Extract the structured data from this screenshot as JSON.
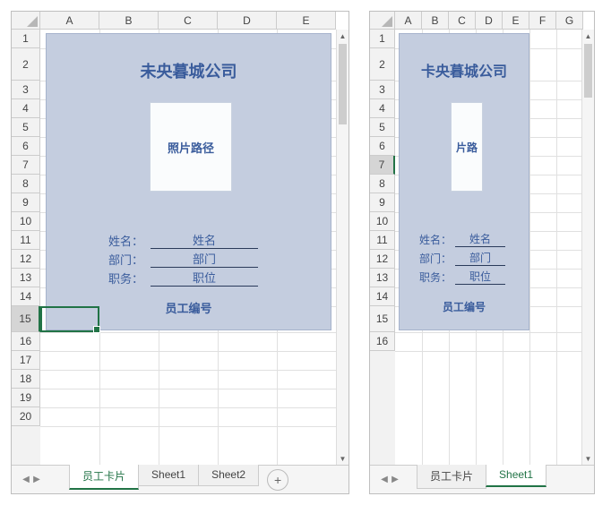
{
  "left": {
    "columns": [
      "A",
      "B",
      "C",
      "D",
      "E"
    ],
    "rows": [
      "1",
      "2",
      "3",
      "4",
      "5",
      "6",
      "7",
      "8",
      "9",
      "10",
      "11",
      "12",
      "13",
      "14",
      "15",
      "16",
      "17",
      "18",
      "19",
      "20"
    ],
    "selected_row": "15",
    "tabs": [
      {
        "label": "员工卡片",
        "active": true
      },
      {
        "label": "Sheet1",
        "active": false
      },
      {
        "label": "Sheet2",
        "active": false
      }
    ],
    "card": {
      "title": "未央暮城公司",
      "photo": "照片路径",
      "fields": [
        {
          "label": "姓名：",
          "value": "姓名"
        },
        {
          "label": "部门：",
          "value": "部门"
        },
        {
          "label": "职务：",
          "value": "职位"
        }
      ],
      "emp_id": "员工编号"
    }
  },
  "right": {
    "columns": [
      "A",
      "B",
      "C",
      "D",
      "E",
      "F",
      "G"
    ],
    "rows": [
      "1",
      "2",
      "3",
      "4",
      "5",
      "6",
      "7",
      "8",
      "9",
      "10",
      "11",
      "12",
      "13",
      "14",
      "15",
      "16"
    ],
    "selected_row": "7",
    "tabs": [
      {
        "label": "员工卡片",
        "active": false
      },
      {
        "label": "Sheet1",
        "active": true
      }
    ],
    "card": {
      "title": "卡央暮城公司",
      "photo": "片路",
      "fields": [
        {
          "label": "姓名：",
          "value": "姓名"
        },
        {
          "label": "部门：",
          "value": "部门"
        },
        {
          "label": "职务：",
          "value": "职位"
        }
      ],
      "emp_id": "员工编号"
    }
  }
}
